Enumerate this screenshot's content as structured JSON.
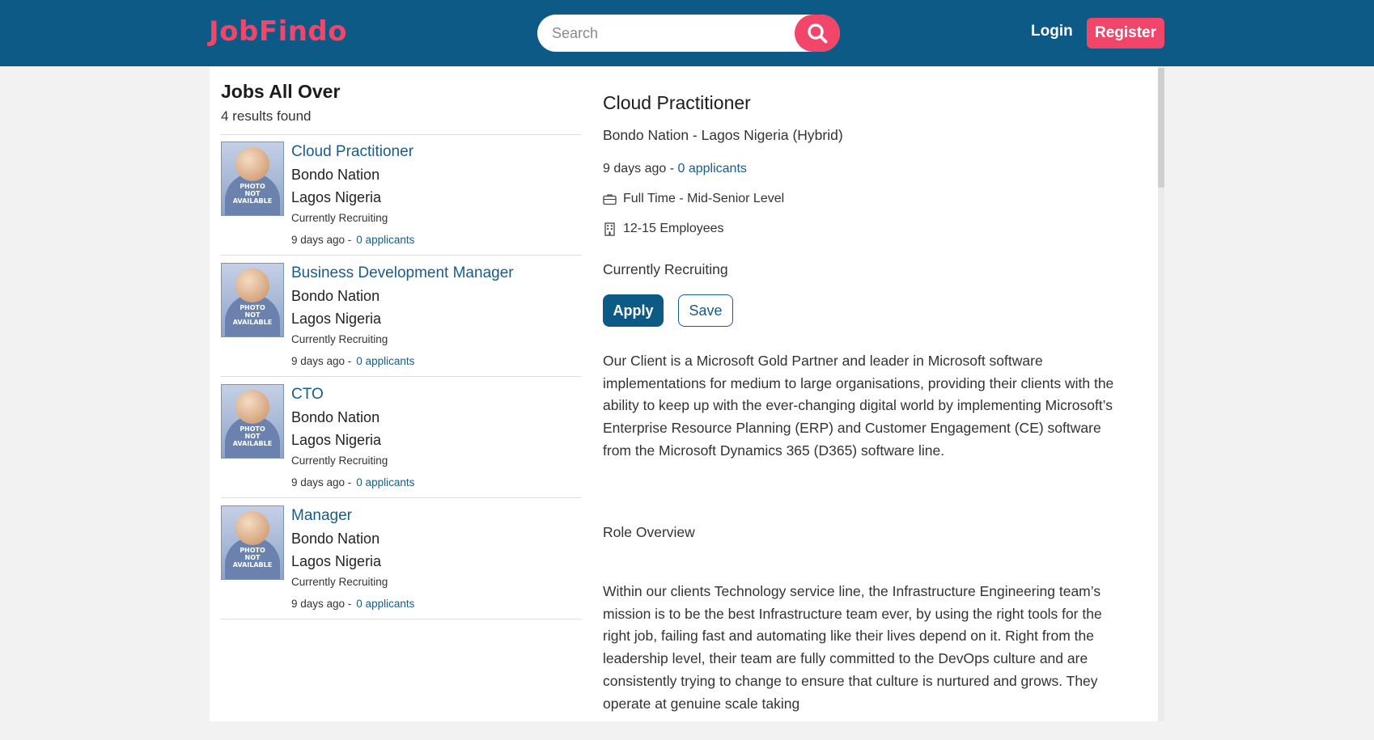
{
  "header": {
    "logo": "JobFindo",
    "search_placeholder": "Search",
    "login_label": "Login",
    "register_label": "Register",
    "colors": {
      "bar": "#0c5a85",
      "accent": "#f2456a"
    }
  },
  "list": {
    "title": "Jobs All Over",
    "results": "4 results found",
    "placeholder_image_text": "PHOTO NOT AVAILABLE",
    "jobs": [
      {
        "title": "Cloud Practitioner",
        "company": "Bondo Nation",
        "location": "Lagos Nigeria",
        "status": "Currently Recruiting",
        "posted": "9 days ago -",
        "applicants": "0 applicants"
      },
      {
        "title": "Business Development Manager",
        "company": "Bondo Nation",
        "location": "Lagos Nigeria",
        "status": "Currently Recruiting",
        "posted": "9 days ago -",
        "applicants": "0 applicants"
      },
      {
        "title": "CTO",
        "company": "Bondo Nation",
        "location": "Lagos Nigeria",
        "status": "Currently Recruiting",
        "posted": "9 days ago -",
        "applicants": "0 applicants"
      },
      {
        "title": "Manager",
        "company": "Bondo Nation",
        "location": "Lagos Nigeria",
        "status": "Currently Recruiting",
        "posted": "9 days ago -",
        "applicants": "0 applicants"
      }
    ]
  },
  "detail": {
    "title": "Cloud Practitioner",
    "subtitle": "Bondo Nation - Lagos Nigeria (Hybrid)",
    "posted": "9 days ago - ",
    "applicants": "0 applicants",
    "job_type": "Full Time - Mid-Senior Level",
    "company_size": "12-15 Employees",
    "status": "Currently Recruiting",
    "apply_label": "Apply",
    "save_label": "Save",
    "paragraphs": [
      "Our Client is a Microsoft Gold Partner and leader in Microsoft software implementations for medium to large organisations, providing their clients with the ability to keep up with the ever-changing digital world by implementing Microsoft’s Enterprise Resource Planning (ERP) and Customer Engagement (CE) software from the Microsoft Dynamics 365 (D365) software line.",
      "Role Overview",
      "Within our clients Technology service line, the Infrastructure Engineering team’s mission is to be the best Infrastructure team ever, by using the right tools for the right job, failing fast and automating like their lives depend on it. Right from the leadership level, their team are fully committed to the DevOps culture and are consistently trying to change to ensure that culture is nurtured and grows. They operate at genuine scale taking"
    ]
  }
}
